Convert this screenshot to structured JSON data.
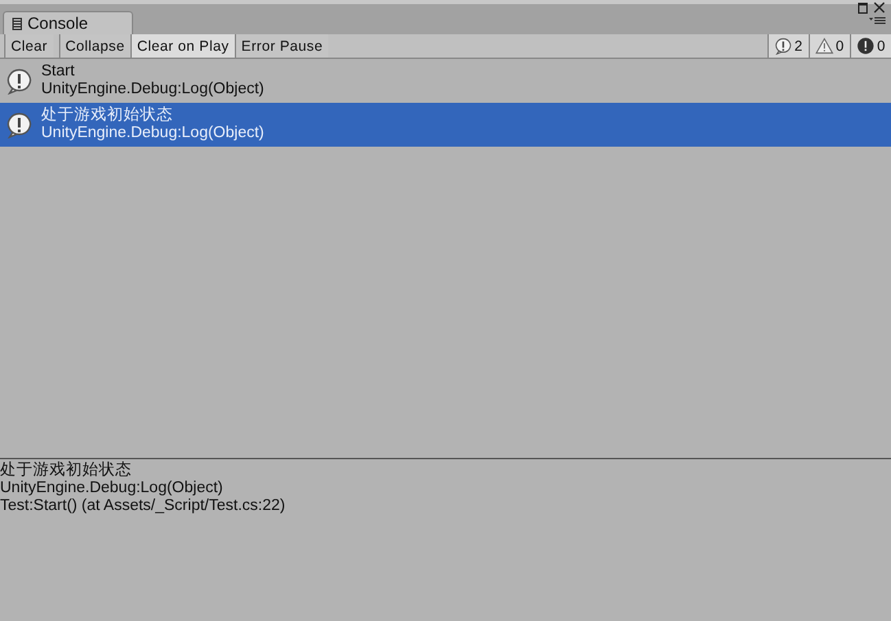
{
  "window": {
    "tab_title": "Console"
  },
  "toolbar": {
    "buttons": [
      {
        "label": "Clear",
        "on": false
      },
      {
        "label": "Collapse",
        "on": false
      },
      {
        "label": "Clear on Play",
        "on": true
      },
      {
        "label": "Error Pause",
        "on": false
      }
    ],
    "counters": [
      {
        "kind": "info",
        "count": "2",
        "on": true
      },
      {
        "kind": "warning",
        "count": "0",
        "on": true
      },
      {
        "kind": "error",
        "count": "0",
        "on": true
      }
    ]
  },
  "log_entries": [
    {
      "kind": "info",
      "message": "Start",
      "source": "UnityEngine.Debug:Log(Object)",
      "selected": false
    },
    {
      "kind": "info",
      "message": "处于游戏初始状态",
      "source": "UnityEngine.Debug:Log(Object)",
      "selected": true
    }
  ],
  "details": [
    "处于游戏初始状态",
    "UnityEngine.Debug:Log(Object)",
    "Test:Start() (at Assets/_Script/Test.cs:22)"
  ]
}
